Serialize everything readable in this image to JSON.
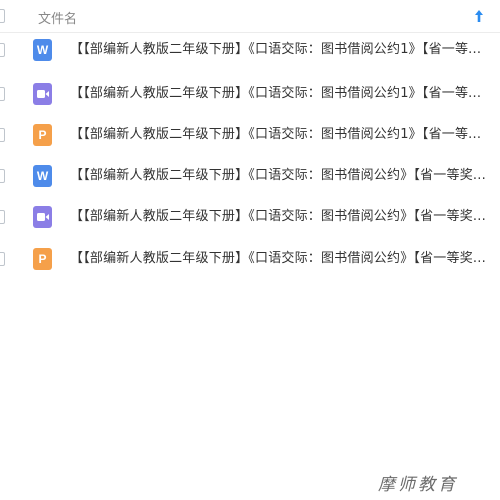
{
  "header": {
    "column_label": "文件名",
    "sort_icon": "sort-ascending-arrow-icon",
    "accent_color": "#2b8cf0"
  },
  "files": [
    {
      "type": "word",
      "icon_label": "W",
      "name": "【【部编新人教版二年级下册】《口语交际：图书借阅公约1》【省一等..."
    },
    {
      "type": "video",
      "icon_label": "",
      "name": "【【部编新人教版二年级下册】《口语交际：图书借阅公约1》【省一等..."
    },
    {
      "type": "ppt",
      "icon_label": "P",
      "name": "【【部编新人教版二年级下册】《口语交际：图书借阅公约1》【省一等..."
    },
    {
      "type": "word",
      "icon_label": "W",
      "name": "【【部编新人教版二年级下册】《口语交际：图书借阅公约》【省一等奖..."
    },
    {
      "type": "video",
      "icon_label": "",
      "name": "【【部编新人教版二年级下册】《口语交际：图书借阅公约》【省一等奖..."
    },
    {
      "type": "ppt",
      "icon_label": "P",
      "name": "【【部编新人教版二年级下册】《口语交际：图书借阅公约》【省一等奖..."
    }
  ],
  "watermark": "摩师教育",
  "colors": {
    "word": "#4e8bea",
    "ppt": "#f5a04a",
    "video": "#8b7ee6"
  }
}
